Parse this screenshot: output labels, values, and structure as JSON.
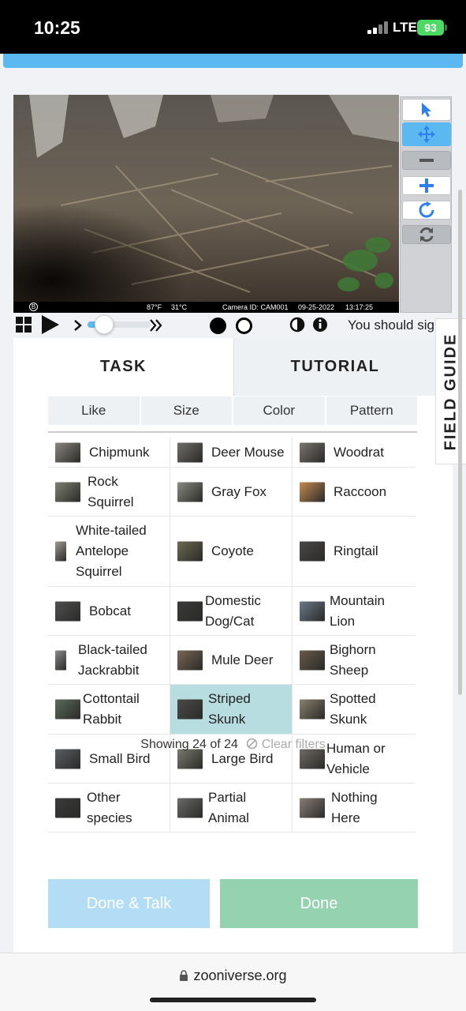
{
  "status_bar": {
    "time": "10:25",
    "network": "LTE",
    "battery": "93"
  },
  "camera_overlay": {
    "logo": "B",
    "temp_f": "87°F",
    "temp_c": "31°C",
    "camera_id": "Camera ID: CAM001",
    "date": "09-25-2022",
    "time": "13:17:25"
  },
  "toolbar": {
    "tools": [
      {
        "name": "pointer-tool",
        "icon": "cursor-arrow-icon",
        "state": "normal"
      },
      {
        "name": "move-tool",
        "icon": "move-arrows-icon",
        "state": "active"
      },
      {
        "name": "zoom-out-tool",
        "icon": "minus-icon",
        "state": "disabled"
      },
      {
        "name": "zoom-in-tool",
        "icon": "plus-icon",
        "state": "normal"
      },
      {
        "name": "rotate-tool",
        "icon": "rotate-icon",
        "state": "normal"
      },
      {
        "name": "reset-tool",
        "icon": "refresh-icon",
        "state": "disabled"
      }
    ]
  },
  "controls": {
    "sign_in_note": "You should sign"
  },
  "tabs": {
    "task": "TASK",
    "tutorial": "TUTORIAL"
  },
  "filters": [
    "Like",
    "Size",
    "Color",
    "Pattern"
  ],
  "species": [
    {
      "label": "Chipmunk",
      "selected": false
    },
    {
      "label": "Deer Mouse",
      "selected": false
    },
    {
      "label": "Woodrat",
      "selected": false
    },
    {
      "label": "Rock Squirrel",
      "selected": false
    },
    {
      "label": "Gray Fox",
      "selected": false
    },
    {
      "label": "Raccoon",
      "selected": false
    },
    {
      "label": "White-tailed Antelope Squirrel",
      "selected": false
    },
    {
      "label": "Coyote",
      "selected": false
    },
    {
      "label": "Ringtail",
      "selected": false
    },
    {
      "label": "Bobcat",
      "selected": false
    },
    {
      "label": "Domestic Dog/Cat",
      "selected": false
    },
    {
      "label": "Mountain Lion",
      "selected": false
    },
    {
      "label": "Black-tailed Jackrabbit",
      "selected": false
    },
    {
      "label": "Mule Deer",
      "selected": false
    },
    {
      "label": "Bighorn Sheep",
      "selected": false
    },
    {
      "label": "Cottontail Rabbit",
      "selected": false
    },
    {
      "label": "Striped Skunk",
      "selected": true
    },
    {
      "label": "Spotted Skunk",
      "selected": false
    },
    {
      "label": "Small Bird",
      "selected": false
    },
    {
      "label": "Large Bird",
      "selected": false
    },
    {
      "label": "Human or Vehicle",
      "selected": false
    },
    {
      "label": "Other species",
      "selected": false
    },
    {
      "label": "Partial Animal",
      "selected": false
    },
    {
      "label": "Nothing Here",
      "selected": false
    }
  ],
  "showing": {
    "text": "Showing 24 of 24",
    "clear": "Clear filters"
  },
  "buttons": {
    "done_talk": "Done & Talk",
    "done": "Done"
  },
  "field_guide": "FIELD GUIDE",
  "browser": {
    "url": "zooniverse.org"
  }
}
